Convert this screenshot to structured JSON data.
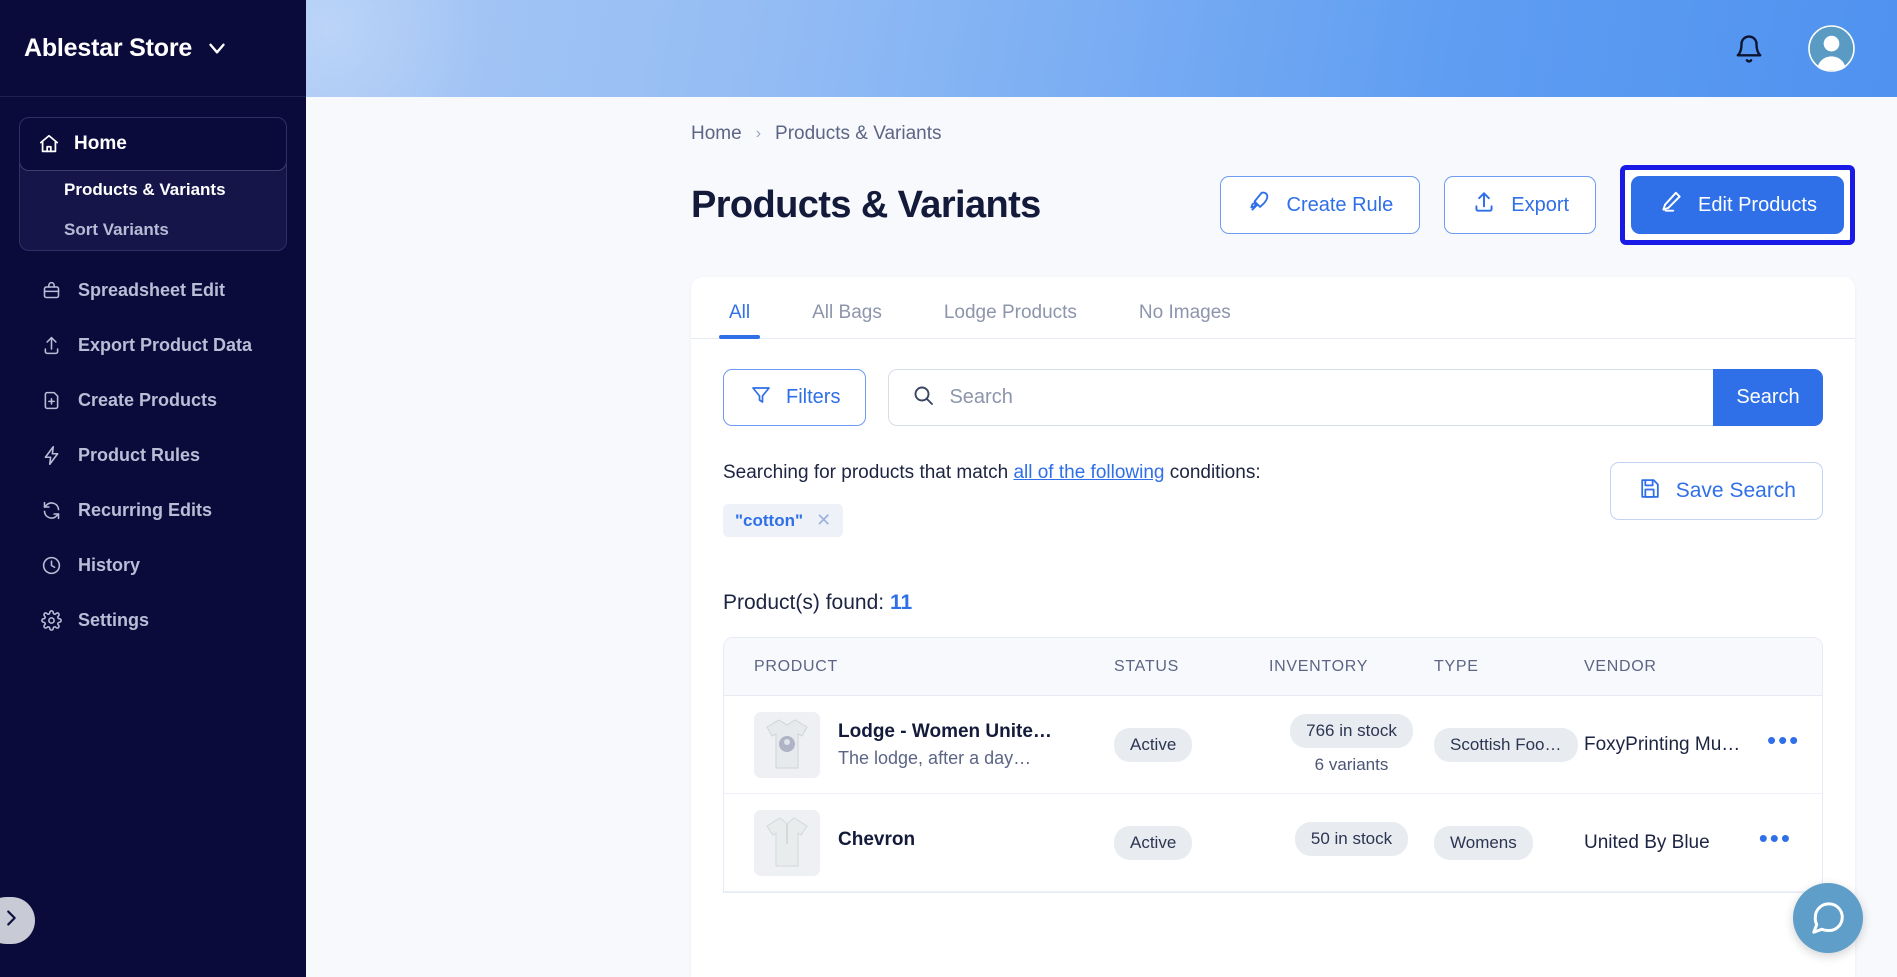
{
  "sidebar": {
    "brand": "Ablestar Store",
    "brand_caret_icon": "chevron-down-icon",
    "home": {
      "label": "Home",
      "icon": "home-icon"
    },
    "sub_items": [
      {
        "label": "Products & Variants",
        "active": true
      },
      {
        "label": "Sort Variants",
        "active": false
      }
    ],
    "items": [
      {
        "label": "Spreadsheet Edit",
        "icon": "spreadsheet-icon"
      },
      {
        "label": "Export Product Data",
        "icon": "upload-icon"
      },
      {
        "label": "Create Products",
        "icon": "file-plus-icon"
      },
      {
        "label": "Product Rules",
        "icon": "lightning-icon"
      },
      {
        "label": "Recurring Edits",
        "icon": "refresh-icon"
      },
      {
        "label": "History",
        "icon": "clock-icon"
      },
      {
        "label": "Settings",
        "icon": "gear-icon"
      }
    ],
    "toggle_icon": "chevron-right-icon"
  },
  "topbar": {
    "bell_icon": "bell-icon",
    "avatar_icon": "user-avatar-icon"
  },
  "breadcrumb": {
    "home": "Home",
    "separator": "›",
    "current": "Products & Variants"
  },
  "page": {
    "title": "Products & Variants"
  },
  "actions": {
    "create_rule": {
      "label": "Create Rule",
      "icon": "rocket-icon"
    },
    "export": {
      "label": "Export",
      "icon": "upload-icon"
    },
    "edit_products": {
      "label": "Edit Products",
      "icon": "pencil-icon",
      "highlighted": true
    }
  },
  "tabs": [
    {
      "label": "All",
      "active": true
    },
    {
      "label": "All Bags",
      "active": false
    },
    {
      "label": "Lodge Products",
      "active": false
    },
    {
      "label": "No Images",
      "active": false
    }
  ],
  "search": {
    "filters_label": "Filters",
    "filters_icon": "funnel-icon",
    "search_icon": "search-icon",
    "placeholder": "Search",
    "value": "",
    "search_button": "Search"
  },
  "conditions": {
    "prefix": "Searching for products that match ",
    "link": "all of the following",
    "suffix": " conditions:",
    "chips": [
      {
        "label": "\"cotton\"",
        "remove_icon": "close-icon"
      }
    ],
    "save_search": {
      "label": "Save Search",
      "icon": "save-icon"
    }
  },
  "results": {
    "label": "Product(s) found:",
    "count": "11"
  },
  "table": {
    "columns": [
      "PRODUCT",
      "STATUS",
      "INVENTORY",
      "TYPE",
      "VENDOR"
    ],
    "rows": [
      {
        "title": "Lodge - Women Unite…",
        "description": "The lodge, after a day…",
        "status": "Active",
        "inventory": "766 in stock",
        "variants": "6 variants",
        "type": "Scottish Foo…",
        "vendor": "FoxyPrinting Mu…",
        "menu_icon": "more-horizontal-icon",
        "thumb_icon": "tshirt-thumbnail"
      },
      {
        "title": "Chevron",
        "description": "",
        "status": "Active",
        "inventory": "50 in stock",
        "variants": "",
        "type": "Womens",
        "vendor": "United By Blue",
        "menu_icon": "more-horizontal-icon",
        "thumb_icon": "shirt-thumbnail"
      }
    ]
  },
  "chat": {
    "icon": "chat-bubble-icon"
  },
  "colors": {
    "accent": "#2f6fe8",
    "sidebar_bg": "#0b0b3b",
    "highlight": "#1a1ae6",
    "page_bg": "#f7f9fc"
  }
}
